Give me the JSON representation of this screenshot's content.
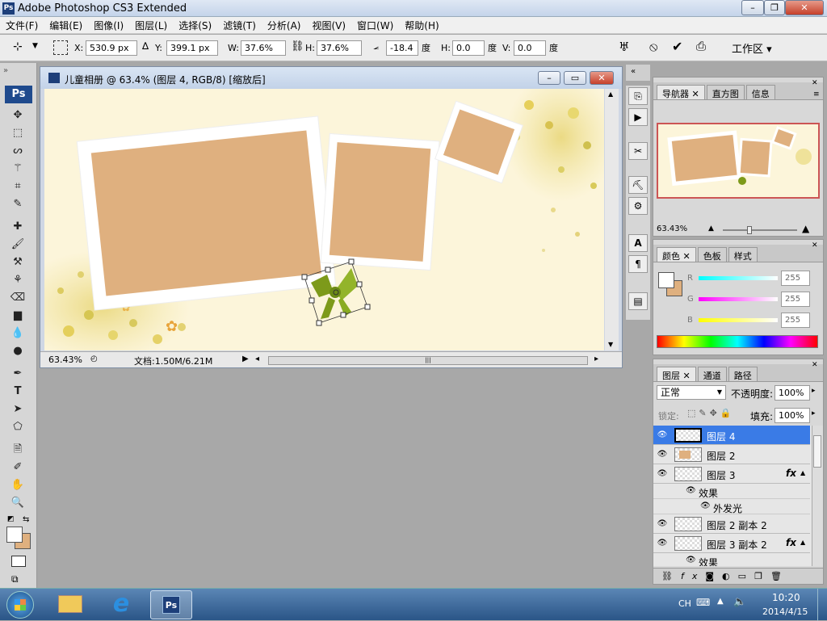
{
  "window": {
    "title": "Adobe Photoshop CS3 Extended",
    "logo": "Ps"
  },
  "menu": [
    "文件(F)",
    "编辑(E)",
    "图像(I)",
    "图层(L)",
    "选择(S)",
    "滤镜(T)",
    "分析(A)",
    "视图(V)",
    "窗口(W)",
    "帮助(H)"
  ],
  "options": {
    "x_label": "X:",
    "x_value": "530.9 px",
    "y_label": "Y:",
    "y_value": "399.1 px",
    "w_label": "W:",
    "w_value": "37.6%",
    "h_label": "H:",
    "h_value": "37.6%",
    "angle_value": "-18.4",
    "angle_unit": "度",
    "hskew_label": "H:",
    "hskew_value": "0.0",
    "hskew_unit": "度",
    "vskew_label": "V:",
    "vskew_value": "0.0",
    "vskew_unit": "度",
    "workspace": "工作区"
  },
  "document": {
    "title": "儿童相册 @ 63.4% (图层 4, RGB/8) [缩放后]",
    "zoom": "63.43%",
    "doc_info": "文档:1.50M/6.21M"
  },
  "navigator": {
    "tabs": [
      "导航器",
      "直方图",
      "信息"
    ],
    "zoom": "63.43%"
  },
  "color": {
    "tabs": [
      "颜色",
      "色板",
      "样式"
    ],
    "r_label": "R",
    "g_label": "G",
    "b_label": "B",
    "r": "255",
    "g": "255",
    "b": "255"
  },
  "layers": {
    "tabs": [
      "图层",
      "通道",
      "路径"
    ],
    "blend_mode": "正常",
    "opacity_label": "不透明度:",
    "opacity": "100%",
    "lock_label": "锁定:",
    "fill_label": "填充:",
    "fill": "100%",
    "items": [
      {
        "name": "图层 4",
        "selected": true,
        "fx": ""
      },
      {
        "name": "图层 2",
        "selected": false,
        "fx": ""
      },
      {
        "name": "图层 3",
        "selected": false,
        "fx": "fx"
      },
      {
        "name": "图层 2 副本 2",
        "selected": false,
        "fx": ""
      },
      {
        "name": "图层 3 副本 2",
        "selected": false,
        "fx": "fx"
      }
    ],
    "effects_label": "效果",
    "outer_glow_label": "外发光"
  },
  "taskbar": {
    "lang": "CH",
    "time": "10:20",
    "date": "2014/4/15",
    "ps_label": "Ps"
  },
  "colors": {
    "photo_fill": "#dfb07f",
    "canvas_bg": "#fcf5da",
    "selection": "#3a7be6"
  }
}
